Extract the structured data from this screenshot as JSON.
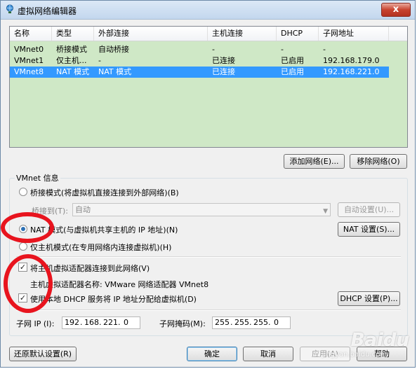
{
  "window": {
    "title": "虚拟网络编辑器",
    "close_label": "x"
  },
  "table": {
    "headers": [
      "名称",
      "类型",
      "外部连接",
      "主机连接",
      "DHCP",
      "子网地址"
    ],
    "rows": [
      [
        "VMnet0",
        "桥接模式",
        "自动桥接",
        "-",
        "-",
        "-"
      ],
      [
        "VMnet1",
        "仅主机...",
        "-",
        "已连接",
        "已启用",
        "192.168.179.0"
      ],
      [
        "VMnet8",
        "NAT 模式",
        "NAT 模式",
        "已连接",
        "已启用",
        "192.168.221.0"
      ]
    ],
    "selected_row": 2
  },
  "buttons": {
    "add_network": "添加网络(E)...",
    "remove_network": "移除网络(O)",
    "auto_settings": "自动设置(U)...",
    "nat_settings": "NAT 设置(S)...",
    "dhcp_settings": "DHCP 设置(P)...",
    "restore_defaults": "还原默认设置(R)",
    "ok": "确定",
    "cancel": "取消",
    "apply": "应用(A)",
    "help": "帮助"
  },
  "vmnet_info": {
    "group_title": "VMnet 信息",
    "bridged_label": "桥接模式(将虚拟机直接连接到外部网络)(B)",
    "bridged_to_label": "桥接到(T):",
    "bridged_to_value": "自动",
    "nat_label": "NAT 模式(与虚拟机共享主机的 IP 地址)(N)",
    "host_only_label": "仅主机模式(在专用网络内连接虚拟机)(H)",
    "connect_adapter_label": "将主机虚拟适配器连接到此网络(V)",
    "adapter_name_label": "主机虚拟适配器名称: VMware 网络适配器 VMnet8",
    "use_dhcp_label": "使用本地 DHCP 服务将 IP 地址分配给虚拟机(D)",
    "selected_mode": "nat",
    "connect_adapter_checked": true,
    "use_dhcp_checked": true
  },
  "subnet": {
    "ip_label": "子网 IP (I):",
    "ip": [
      "192",
      "168",
      "221",
      "0"
    ],
    "mask_label": "子网掩码(M):",
    "mask": [
      "255",
      "255",
      "255",
      "0"
    ]
  },
  "watermark": {
    "text": "Baidu",
    "sub": "jingyan.baidu.com"
  },
  "colors": {
    "selection": "#3399ff",
    "list_bg": "#cfe8c6",
    "annotation": "#e8141e"
  }
}
